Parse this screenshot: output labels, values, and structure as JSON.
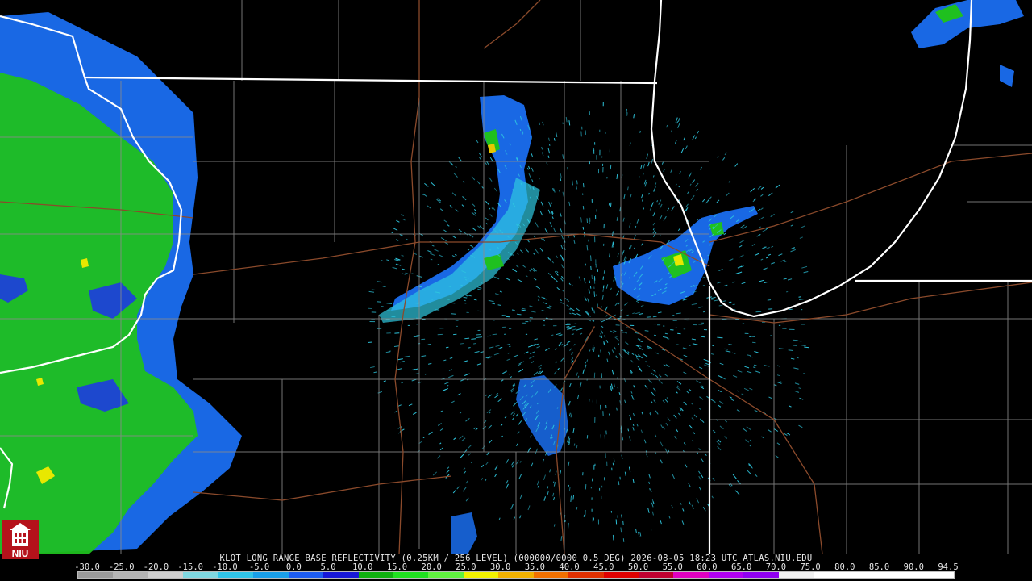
{
  "caption": "KLOT LONG RANGE BASE REFLECTIVITY (0.25KM / 256 LEVEL) (000000/0000 0.5 DEG) 2026-08-05 18:23 UTC  ATLAS.NIU.EDU",
  "logo": {
    "text": "NIU",
    "colors": {
      "background": "#b5121b",
      "foreground": "#ffffff"
    }
  },
  "scale": {
    "ticks": [
      "-30.0",
      "-25.0",
      "-20.0",
      "-15.0",
      "-10.0",
      "-5.0",
      "0.0",
      "5.0",
      "10.0",
      "15.0",
      "20.0",
      "25.0",
      "30.0",
      "35.0",
      "40.0",
      "45.0",
      "50.0",
      "55.0",
      "60.0",
      "65.0",
      "70.0",
      "75.0",
      "80.0",
      "85.0",
      "90.0",
      "94.5"
    ],
    "colors": [
      "#9a9a9a",
      "#b4b4b4",
      "#cfcfcf",
      "#7fd7e0",
      "#30c4e8",
      "#1a9fe8",
      "#1d5cf0",
      "#1818d8",
      "#10b010",
      "#20e020",
      "#60f040",
      "#f0f000",
      "#f0b000",
      "#f07000",
      "#e03000",
      "#e00000",
      "#c00030",
      "#e000c0",
      "#b000f0",
      "#9000f0",
      "#f0f0f0",
      "#ffffff",
      "#ffffff",
      "#ffffff",
      "#ffffff"
    ]
  },
  "map": {
    "colors": {
      "background": "#000000",
      "state_lines": "#ffffff",
      "county_lines": "#8a8a8a",
      "highways": "#8b4a2b",
      "light_echo": "#2fc8e0",
      "blue_echo": "#1a6ef0",
      "green_echo": "#1fc01f",
      "yellow_echo": "#e8e800"
    }
  }
}
